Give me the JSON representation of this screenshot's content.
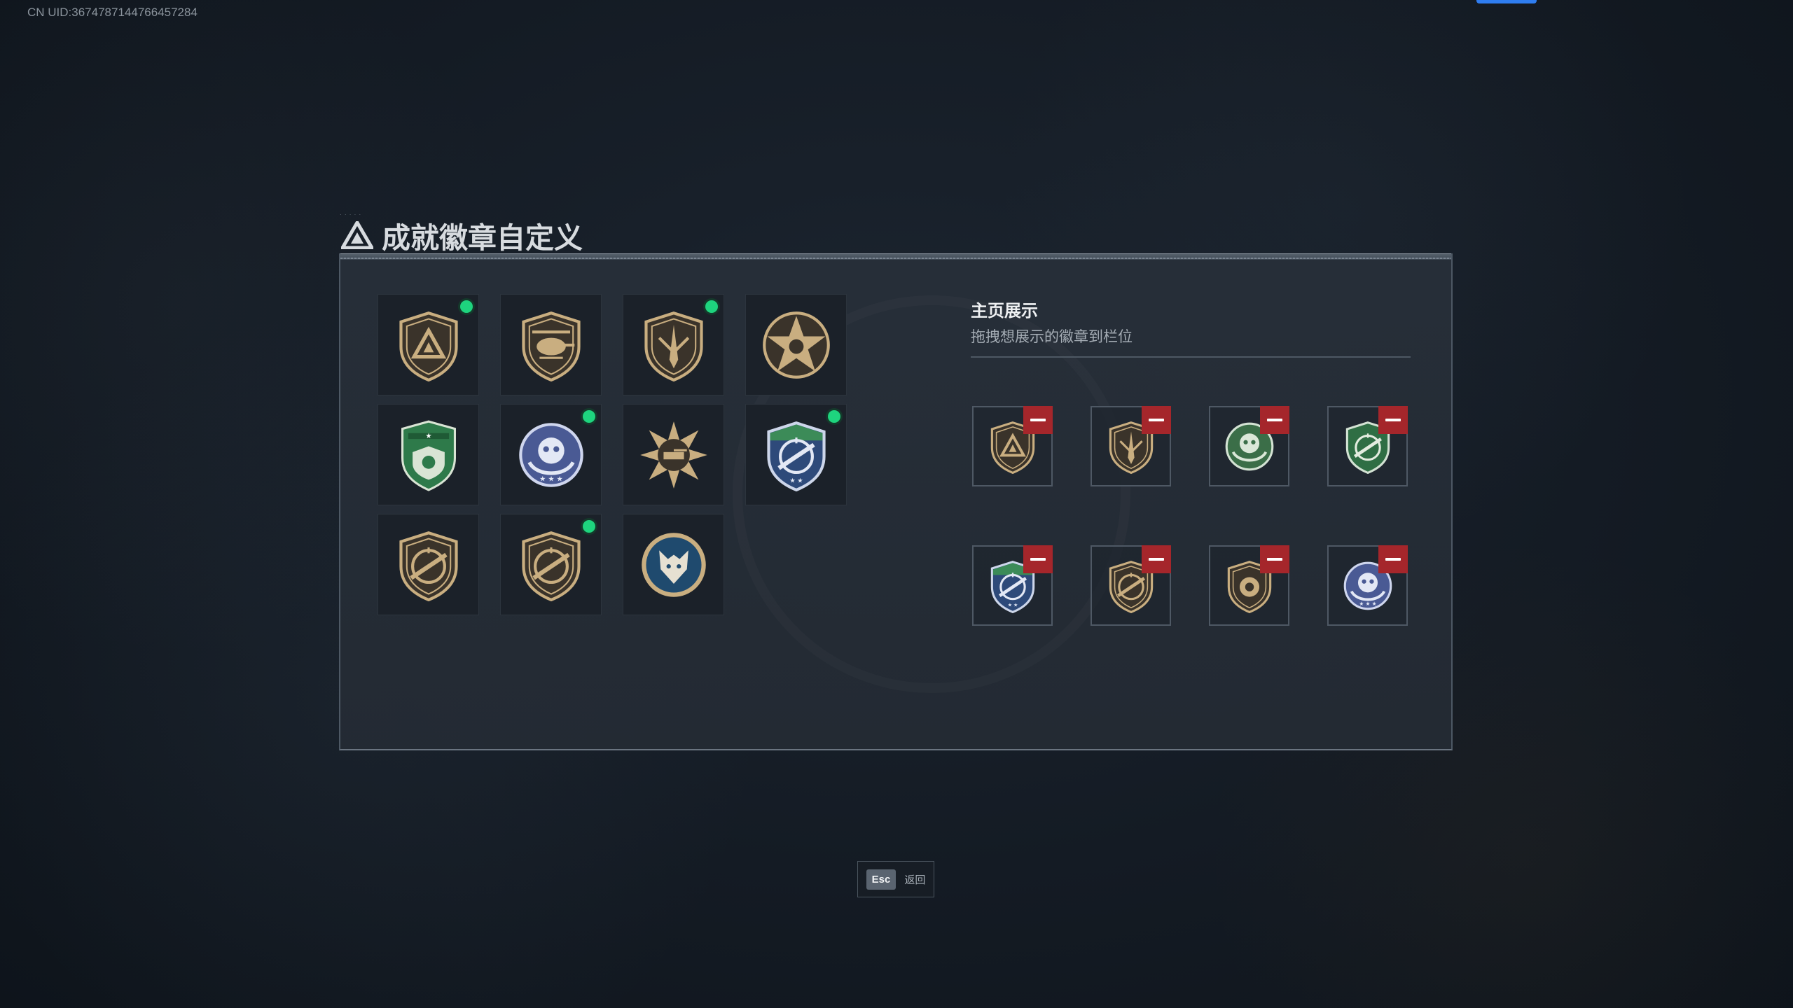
{
  "uid_text": "CN UID:3674787144766457284",
  "dialog": {
    "title": "成就徽章自定义",
    "title_icon": "delta-logo-icon"
  },
  "colors": {
    "new_indicator": "#1ed47e",
    "remove_button": "#a5262b",
    "panel_bg": "#28303a"
  },
  "badge_grid": {
    "items": [
      {
        "icon": "delta-shield-badge-icon",
        "new": true
      },
      {
        "icon": "helicopter-badge-icon",
        "new": false
      },
      {
        "icon": "dagger-shield-badge-icon",
        "new": true
      },
      {
        "icon": "star-skull-badge-icon",
        "new": false
      },
      {
        "icon": "green-star-shield-badge-icon",
        "new": false
      },
      {
        "icon": "skull-laurel-badge-icon",
        "new": true
      },
      {
        "icon": "tank-burst-badge-icon",
        "new": false
      },
      {
        "icon": "rifle-crosshair-blue-badge-icon",
        "new": true
      },
      {
        "icon": "rifle-crosshair-bronze-badge-icon",
        "new": false
      },
      {
        "icon": "rifle-crosshair-bronze-2-badge-icon",
        "new": true
      },
      {
        "icon": "wolf-emblem-badge-icon",
        "new": false
      }
    ]
  },
  "showcase": {
    "title": "主页展示",
    "subtitle": "拖拽想展示的徽章到栏位",
    "slots": [
      {
        "icon": "delta-shield-badge-icon"
      },
      {
        "icon": "dagger-shield-badge-icon"
      },
      {
        "icon": "green-skull-laurel-badge-icon"
      },
      {
        "icon": "green-rifle-crosshair-badge-icon"
      },
      {
        "icon": "rifle-crosshair-blue-badge-icon"
      },
      {
        "icon": "rifle-crosshair-bronze-badge-icon"
      },
      {
        "icon": "bronze-emblem-badge-icon"
      },
      {
        "icon": "skull-laurel-badge-icon"
      }
    ]
  },
  "footer": {
    "key_label": "Esc",
    "action_label": "返回"
  }
}
